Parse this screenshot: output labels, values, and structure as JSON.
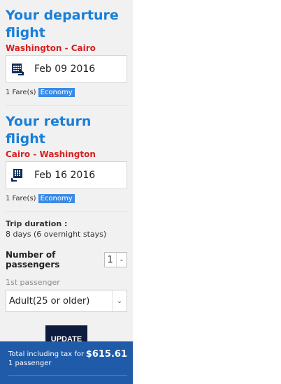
{
  "departure": {
    "title": "Your departure flight",
    "route": "Washington - Cairo",
    "date": "Feb 09 2016",
    "fares": "1 Fare(s)",
    "cabin": "Economy"
  },
  "return": {
    "title": "Your return flight",
    "route": "Cairo - Washington",
    "date": "Feb 16 2016",
    "fares": "1 Fare(s)",
    "cabin": "Economy"
  },
  "trip": {
    "label": "Trip duration :",
    "value": "8 days (6 overnight stays)"
  },
  "passengers": {
    "label": "Number of passengers",
    "count": "1",
    "first_label": "1st passenger",
    "first_type": "Adult(25 or older)"
  },
  "update_label": "UPDATE",
  "total": {
    "label": "Total including tax for 1 passenger",
    "amount": "$615.61"
  },
  "colors": {
    "accent": "#1a7fd8",
    "route": "#d62020",
    "badge": "#3b8be6",
    "button": "#0d1b3e",
    "total_bg": "#1f5ba8"
  },
  "icons": {
    "departure_date": "calendar-departure-icon",
    "return_date": "calendar-return-icon",
    "select_arrow": "chevron-down-icon"
  }
}
